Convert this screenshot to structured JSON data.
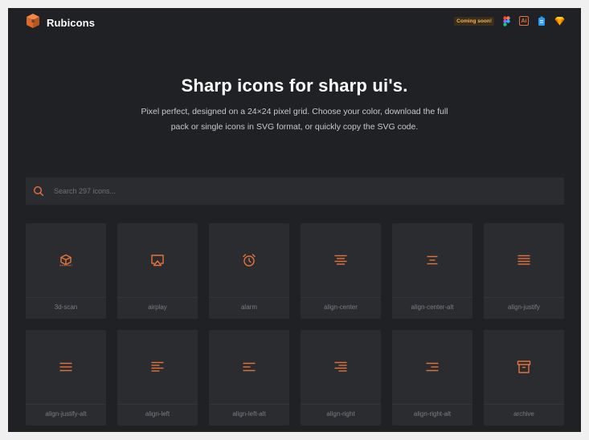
{
  "app": {
    "name": "Rubicons",
    "accent": "#e3733c"
  },
  "toolbar": {
    "coming_soon": "Coming soon!",
    "ai_label": "Ai",
    "icons": [
      "figma-icon",
      "illustrator-icon",
      "sketch-file-icon",
      "sketch-diamond-icon"
    ]
  },
  "hero": {
    "title": "Sharp icons for sharp ui's.",
    "subtitle": "Pixel perfect, designed on a 24×24 pixel grid. Choose your color, download the full pack or single icons in SVG format, or quickly copy the SVG code."
  },
  "search": {
    "placeholder": "Search 297 icons...",
    "value": ""
  },
  "icons": [
    {
      "name": "3d-scan",
      "icon": "3d-scan-icon"
    },
    {
      "name": "airplay",
      "icon": "airplay-icon"
    },
    {
      "name": "alarm",
      "icon": "alarm-icon"
    },
    {
      "name": "align-center",
      "icon": "align-center-icon"
    },
    {
      "name": "align-center-alt",
      "icon": "align-center-alt-icon"
    },
    {
      "name": "align-justify",
      "icon": "align-justify-icon"
    },
    {
      "name": "align-justify-alt",
      "icon": "align-justify-alt-icon"
    },
    {
      "name": "align-left",
      "icon": "align-left-icon"
    },
    {
      "name": "align-left-alt",
      "icon": "align-left-alt-icon"
    },
    {
      "name": "align-right",
      "icon": "align-right-icon"
    },
    {
      "name": "align-right-alt",
      "icon": "align-right-alt-icon"
    },
    {
      "name": "archive",
      "icon": "archive-icon"
    }
  ]
}
